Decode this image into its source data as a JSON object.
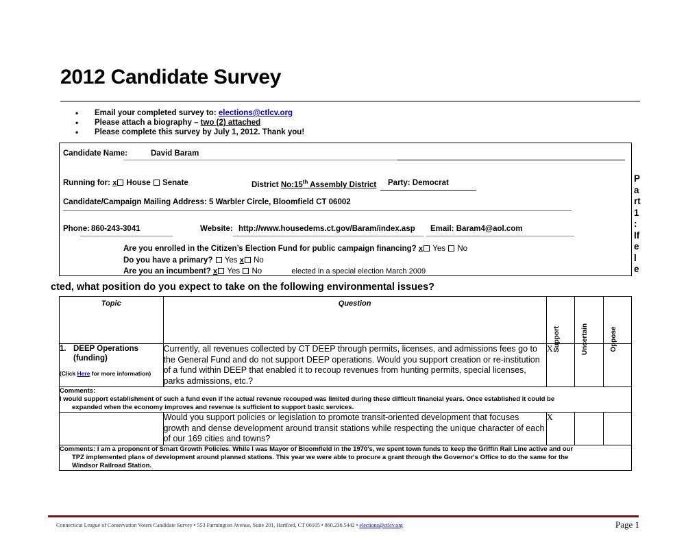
{
  "document": {
    "title": "2012 Candidate Survey",
    "instructions": [
      {
        "prefix": "Email your completed survey to: ",
        "link": "elections@ctlcv.org",
        "suffix": ""
      },
      {
        "prefix": "Please attach a biography – ",
        "underline": "two (2) attached",
        "suffix": ""
      },
      {
        "prefix": "Please complete this survey by July 1, 2012.  Thank you!",
        "suffix": ""
      }
    ]
  },
  "candidate_info": {
    "name_label": "Candidate Name:",
    "name_value": "David Baram",
    "running_for_label": "Running for:",
    "house_mark": "x",
    "house_label": "House",
    "senate_mark": "",
    "senate_label": "Senate",
    "district_label": "District",
    "district_value_prefix": "No:15",
    "district_value_sup": "th",
    "district_value_suffix": " Assembly District",
    "party_label": "Party: Democrat",
    "address_label": "Candidate/Campaign Mailing Address:",
    "address_value": "5 Warbler Circle, Bloomfield CT 06002",
    "phone_label": "Phone:",
    "phone_value": "860-243-3041",
    "website_label": "Website:",
    "website_value": "http://www.housedems.ct.gov/Baram/index.asp",
    "email_label": "Email:",
    "email_value": "Baram4@aol.com",
    "questions": [
      {
        "text": "Are you enrolled in the Citizen’s Election Fund for public campaign financing?",
        "yes_mark": "x",
        "yes_label": "Yes",
        "no_mark": "",
        "no_label": "No",
        "note": ""
      },
      {
        "text": "Do you have a primary?",
        "yes_mark": "",
        "yes_label": "Yes",
        "no_mark": "x",
        "no_label": "No",
        "note": ""
      },
      {
        "text": "Are you an incumbent?",
        "yes_mark": "x",
        "yes_label": "Yes",
        "no_mark": "",
        "no_label": "No",
        "note": "elected in a special election March 2009"
      }
    ]
  },
  "part_heading": {
    "vertical_chars": [
      "P",
      "a",
      "rt",
      "1",
      ":",
      "If",
      "e",
      "l",
      "e"
    ],
    "continuation": "cted, what position do you expect to take on the following environmental issues?"
  },
  "survey_table": {
    "headers": {
      "topic": "Topic",
      "question": "Question",
      "support": "Support",
      "uncertain": "Uncertain",
      "oppose": "Oppose"
    },
    "rows": [
      {
        "number": "1.",
        "topic": "DEEP Operations (funding)",
        "topic_line1": "DEEP Operations",
        "topic_line2": "(funding)",
        "topic_note_prefix": "(Click ",
        "topic_note_link": "Here",
        "topic_note_suffix": " for more information)",
        "question": "Currently, all revenues collected by CT DEEP through permits, licenses, and admissions fees go to the General Fund and do not support DEEP operations.  Would you support creation or re-institution of a fund within DEEP that enabled it to recoup revenues from hunting permits, special licenses, parks admissions, etc.?",
        "support": "X",
        "uncertain": "",
        "oppose": "",
        "comments_label": "Comments:",
        "comments_line1": "I would support establishment of such a fund even if the actual revenue recouped was limited during these difficult financial years.  Once established it could be",
        "comments_line2": "expanded when the economy improves and revenue is sufficient to support basic services."
      },
      {
        "number": "",
        "topic": "",
        "topic_line1": "",
        "topic_line2": "",
        "topic_note_prefix": "",
        "topic_note_link": "",
        "topic_note_suffix": "",
        "question": "Would you support policies or legislation to promote transit-oriented development that focuses growth and dense development around transit stations while respecting the unique character of each of our 169 cities and towns?",
        "support": "X",
        "uncertain": "",
        "oppose": "",
        "comments_label": "Comments:",
        "comments_line1": "Comments: I am a proponent of Smart Growth Policies.  While I was Mayor of Bloomfield in the 1970's, we spent town funds to keep the Griffin Rail Line active and our",
        "comments_line2": "TPZ implemented plans of development around planned stations.  This year we were able to procure a grant through the Governor's Office to do the same for the",
        "comments_line3": "Windsor Railroad Station."
      }
    ]
  },
  "footer": {
    "text_prefix": "Connecticut League of Conservation Voters Candidate Survey  • 553 Farmington Avenue, Suite 201, Hartford, CT 06105 • 860.236.5442 • ",
    "email": "elections@ctlcv.org",
    "page": "Page 1",
    "rule_color": "#7b1010"
  }
}
